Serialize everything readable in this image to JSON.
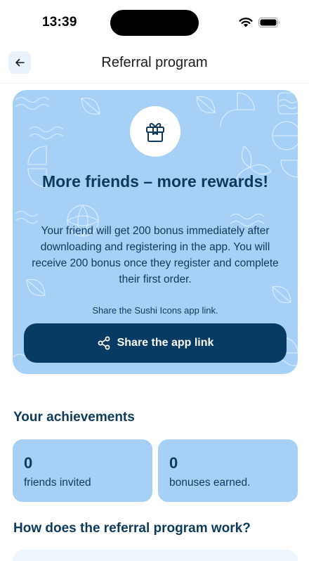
{
  "status_bar": {
    "time": "13:39"
  },
  "header": {
    "title": "Referral program"
  },
  "promo": {
    "heading": "More friends – more rewards!",
    "body": "Your friend will get 200 bonus immediately after downloading and registering in the app. You will receive 200 bonus once they register and complete their first order.",
    "hint": "Share the Sushi Icons app link.",
    "share_label": "Share the app link"
  },
  "achievements": {
    "title": "Your achievements",
    "items": [
      {
        "value": "0",
        "label": "friends invited"
      },
      {
        "value": "0",
        "label": "bonuses earned."
      }
    ]
  },
  "how_it_works": {
    "title": "How does the referral program work?"
  },
  "colors": {
    "accent": "#073b63",
    "card": "#a6d0f5",
    "text": "#0d3a5c"
  },
  "icons": [
    "wifi-icon",
    "battery-icon",
    "back-arrow-icon",
    "gift-icon",
    "share-icon"
  ]
}
